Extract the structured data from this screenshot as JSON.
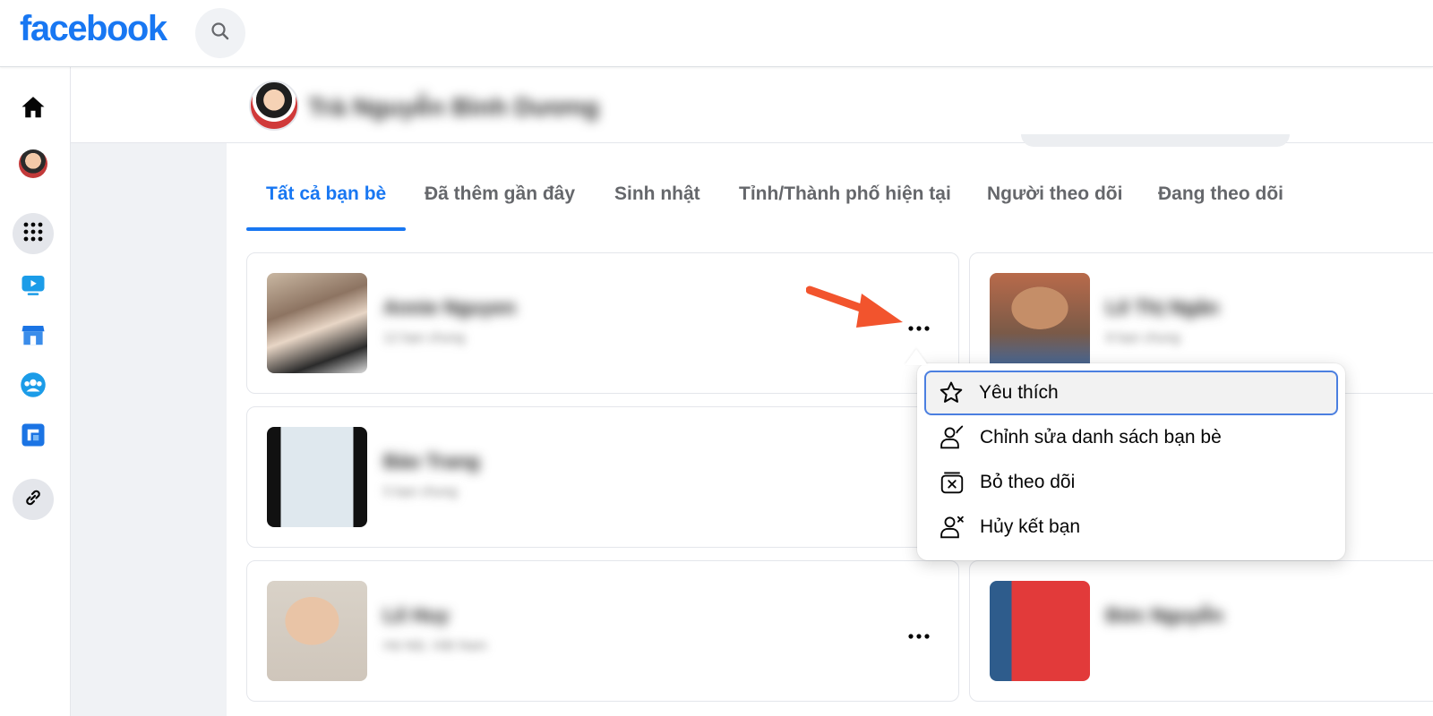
{
  "brand": {
    "logo_text": "facebook",
    "color": "#1877f2"
  },
  "header": {
    "search_icon": "search-icon",
    "profile_name": "Trà Nguyễn Bình Dương"
  },
  "left_rail": {
    "items": [
      {
        "icon": "home-icon"
      },
      {
        "icon": "profile-avatar"
      },
      {
        "icon": "menu-grid-icon"
      },
      {
        "icon": "watch-icon"
      },
      {
        "icon": "marketplace-icon"
      },
      {
        "icon": "groups-icon"
      },
      {
        "icon": "gaming-icon"
      },
      {
        "icon": "link-icon"
      }
    ]
  },
  "tabs": [
    {
      "label": "Tất cả bạn bè",
      "active": true
    },
    {
      "label": "Đã thêm gần đây",
      "active": false
    },
    {
      "label": "Sinh nhật",
      "active": false
    },
    {
      "label": "Tỉnh/Thành phố hiện tại",
      "active": false
    },
    {
      "label": "Người theo dõi",
      "active": false
    },
    {
      "label": "Đang theo dõi",
      "active": false
    }
  ],
  "friends": [
    {
      "name": "Annie Nguyen",
      "sub": "12 bạn chung"
    },
    {
      "name": "Lê Thị Ngân",
      "sub": "8 bạn chung"
    },
    {
      "name": "Bảo Trang",
      "sub": "5 bạn chung"
    },
    {
      "name": "Lê Huy",
      "sub": "Hà Nội, Việt Nam"
    },
    {
      "name": "Đức Nguyễn",
      "sub": ""
    }
  ],
  "context_menu": {
    "items": [
      {
        "icon": "star-icon",
        "label": "Yêu thích"
      },
      {
        "icon": "edit-friend-list-icon",
        "label": "Chỉnh sửa danh sách bạn bè"
      },
      {
        "icon": "unfollow-icon",
        "label": "Bỏ theo dõi"
      },
      {
        "icon": "unfriend-icon",
        "label": "Hủy kết bạn"
      }
    ]
  },
  "colors": {
    "accent": "#1877f2",
    "arrow": "#f2542d",
    "focus_ring": "#4b7fe0"
  }
}
